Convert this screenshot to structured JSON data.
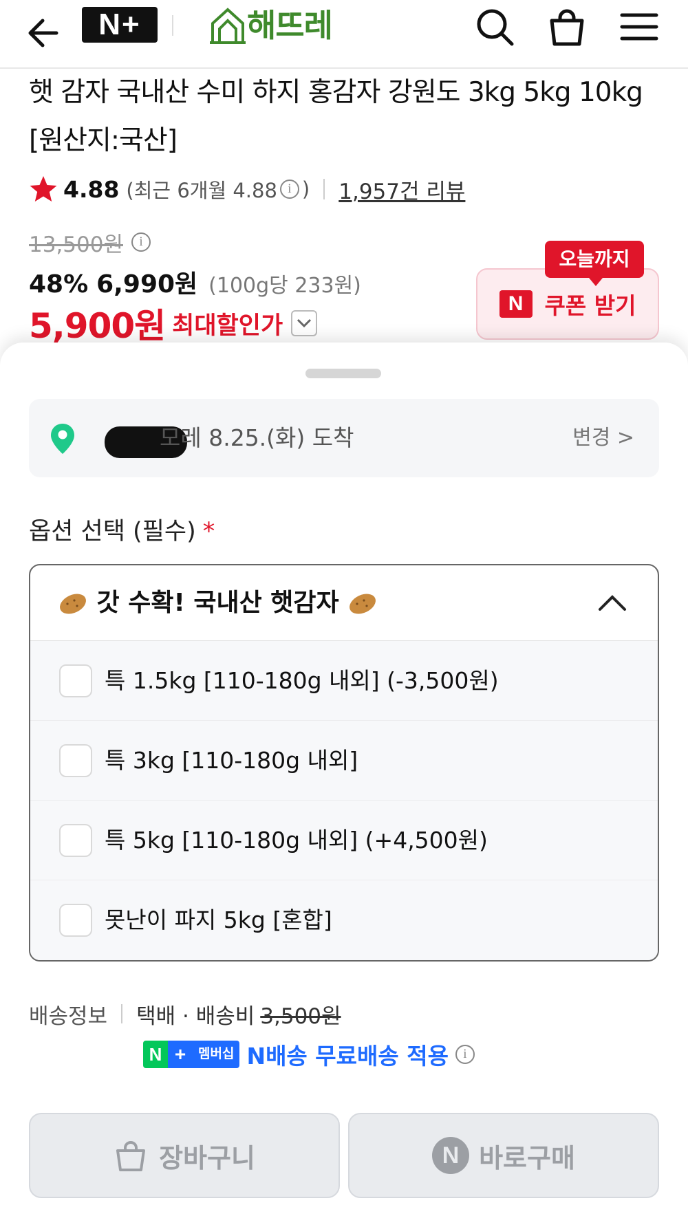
{
  "header": {
    "membership_logo": "N+",
    "store_name": "해뜨레",
    "icons": [
      "back-arrow-icon",
      "search-icon",
      "cart-icon",
      "hamburger-menu-icon"
    ]
  },
  "product": {
    "title": "햇 감자 국내산 수미 하지 홍감자 강원도 3kg 5kg 10kg [원산지:국산]",
    "rating": "4.88",
    "rating_recent": "(최근 6개월 4.88",
    "rating_recent_close": ")",
    "reviews": "1,957건 리뷰",
    "original_price": "13,500원",
    "discount_rate": "48%",
    "sale_price": "6,990원",
    "unit_price": "(100g당 233원)",
    "best_price": "5,900원",
    "best_price_label": "최대할인가"
  },
  "coupon": {
    "badge": "오늘까지",
    "n_mark": "N",
    "label": "쿠폰 받기"
  },
  "delivery": {
    "arrival": "모레 8.25.(화) 도착",
    "change": "변경 >"
  },
  "options": {
    "heading": "옵션 선택 (필수)",
    "required": "*",
    "group_title": "갓 수확! 국내산 햇감자",
    "items": [
      {
        "label": "특 1.5kg [110-180g 내외] (-3,500원)"
      },
      {
        "label": "특 3kg [110-180g 내외]"
      },
      {
        "label": "특 5kg [110-180g 내외] (+4,500원)"
      },
      {
        "label": "못난이 파지 5kg [혼합]"
      }
    ]
  },
  "shipping": {
    "label": "배송정보",
    "method": "택배 · 배송비",
    "fee_original": "3,500원",
    "badge_n": "N",
    "badge_plus": "+",
    "badge_member": "멤버십",
    "free_text": "N배송 무료배송 적용"
  },
  "actions": {
    "cart": "장바구니",
    "buy_n": "N",
    "buy": "바로구매"
  },
  "colors": {
    "accent_red": "#e0152a",
    "naver_green": "#03c75a",
    "membership_blue": "#1e6bff",
    "store_green": "#3f8a2c"
  }
}
